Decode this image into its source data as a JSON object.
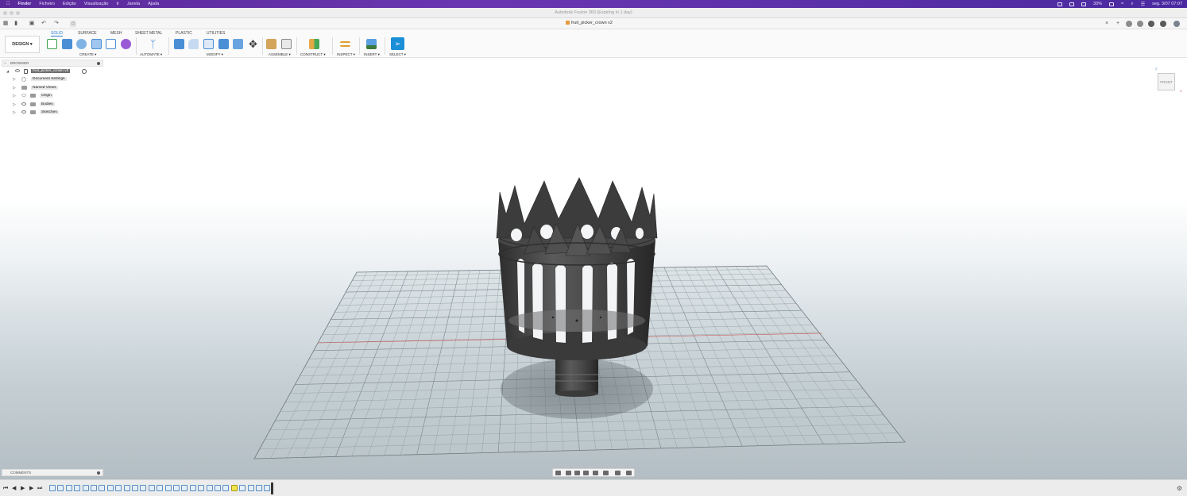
{
  "menubar": {
    "items": [
      "Finder",
      "Ficheiro",
      "Edição",
      "Visualização",
      "Ir",
      "Janela",
      "Ajuda"
    ],
    "battery": "33%",
    "clock": "seg. 3/07  07:07"
  },
  "window": {
    "title": "Autodesk Fusion 360 (Expiring in 1 day)"
  },
  "document": {
    "tab": "fruit_picker_crown v2"
  },
  "ribbon": {
    "workspace": "DESIGN ▾",
    "tabs": [
      "SOLID",
      "SURFACE",
      "MESH",
      "SHEET METAL",
      "PLASTIC",
      "UTILITIES"
    ],
    "active_tab": "SOLID",
    "groups": {
      "create": "CREATE ▾",
      "automate": "AUTOMATE ▾",
      "modify": "MODIFY ▾",
      "assemble": "ASSEMBLE ▾",
      "construct": "CONSTRUCT ▾",
      "inspect": "INSPECT ▾",
      "insert": "INSERT ▾",
      "select": "SELECT ▾"
    }
  },
  "browser": {
    "title": "BROWSER",
    "root": "fruit_picker_crown v2",
    "items": [
      "Document Settings",
      "Named Views",
      "Origin",
      "Bodies",
      "Sketches"
    ]
  },
  "viewcube": {
    "face": "FRONT",
    "axis_z": "Z",
    "axis_x": "X"
  },
  "comments": {
    "title": "COMMENTS"
  },
  "colors": {
    "accent": "#2a7fd0",
    "menubar": "#5a2a9a",
    "body": "#4a4a4a"
  },
  "icons": [
    "apple-icon",
    "grid-icon",
    "file-icon",
    "save-icon",
    "undo-icon",
    "redo-icon",
    "home-icon",
    "close-icon",
    "plus-icon",
    "gear-icon",
    "help-icon",
    "avatar"
  ]
}
